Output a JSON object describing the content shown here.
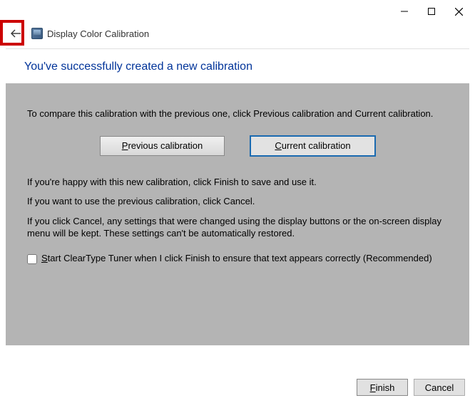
{
  "window": {
    "title": "Display Color Calibration"
  },
  "heading": "You've successfully created a new calibration",
  "content": {
    "compare_text": "To compare this calibration with the previous one, click Previous calibration and Current calibration.",
    "btn_prev_prefix": "P",
    "btn_prev_rest": "revious calibration",
    "btn_curr_prefix": "C",
    "btn_curr_rest": "urrent calibration",
    "happy_text": "If you're happy with this new calibration, click Finish to save and use it.",
    "previous_text": "If you want to use the previous calibration, click Cancel.",
    "cancel_text": "If you click Cancel, any settings that were changed using the display buttons or the on-screen display menu will be kept. These settings can't be automatically restored.",
    "cleartype_prefix": "S",
    "cleartype_rest": "tart ClearType Tuner when I click Finish to ensure that text appears correctly (Recommended)"
  },
  "footer": {
    "finish_prefix": "F",
    "finish_rest": "inish",
    "cancel": "Cancel"
  }
}
